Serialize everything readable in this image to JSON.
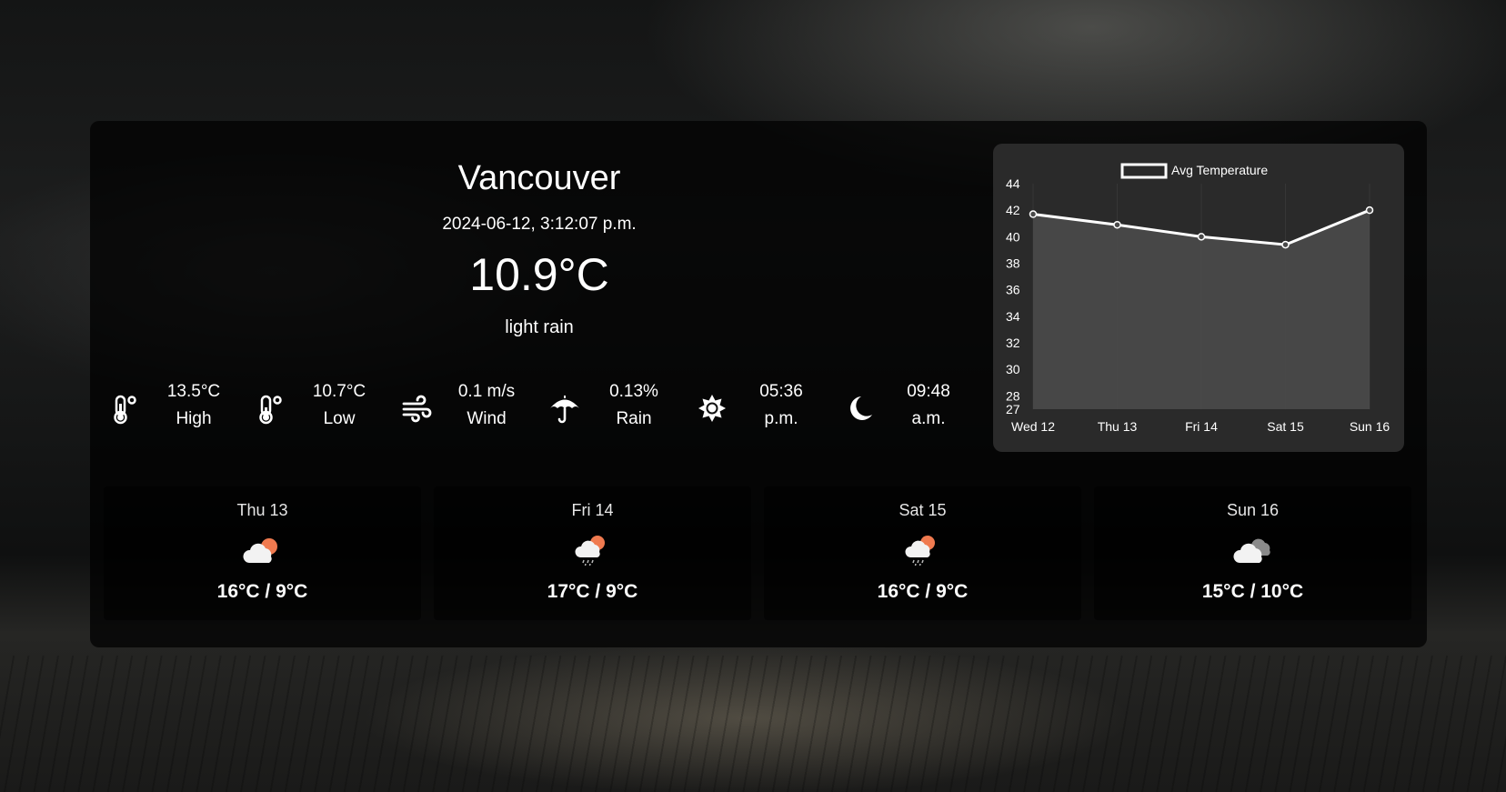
{
  "current": {
    "city": "Vancouver",
    "datetime": "2024-06-12, 3:12:07 p.m.",
    "temperature": "10.9°C",
    "description": "light rain"
  },
  "stats": [
    {
      "icon": "thermometer-icon",
      "value": "13.5°C",
      "label": "High"
    },
    {
      "icon": "thermometer-icon",
      "value": "10.7°C",
      "label": "Low"
    },
    {
      "icon": "wind-icon",
      "value": "0.1 m/s",
      "label": "Wind"
    },
    {
      "icon": "umbrella-icon",
      "value": "0.13%",
      "label": "Rain"
    },
    {
      "icon": "sun-icon",
      "value": "05:36",
      "label": "p.m."
    },
    {
      "icon": "moon-icon",
      "value": "09:48",
      "label": "a.m."
    }
  ],
  "forecast": [
    {
      "day": "Thu 13",
      "icon": "partly-cloudy-icon",
      "range": "16°C / 9°C"
    },
    {
      "day": "Fri 14",
      "icon": "rain-cloud-sun-icon",
      "range": "17°C / 9°C"
    },
    {
      "day": "Sat 15",
      "icon": "rain-cloud-sun-icon",
      "range": "16°C / 9°C"
    },
    {
      "day": "Sun 16",
      "icon": "cloudy-icon",
      "range": "15°C / 10°C"
    }
  ],
  "colors": {
    "accent_sun": "#f07a4f",
    "chart_fill": "#4a4a4a",
    "chart_line": "#ffffff"
  },
  "chart_data": {
    "type": "area",
    "categories": [
      "Wed 12",
      "Thu 13",
      "Fri 14",
      "Sat 15",
      "Sun 16"
    ],
    "series": [
      {
        "name": "Avg Temperature",
        "values": [
          41.7,
          40.9,
          40.0,
          39.4,
          42.0
        ]
      }
    ],
    "yticks": [
      "44",
      "42",
      "40",
      "38",
      "36",
      "34",
      "32",
      "30",
      "28",
      "27"
    ],
    "ylim": [
      27,
      44
    ],
    "legend": "top-center",
    "grid": false
  }
}
